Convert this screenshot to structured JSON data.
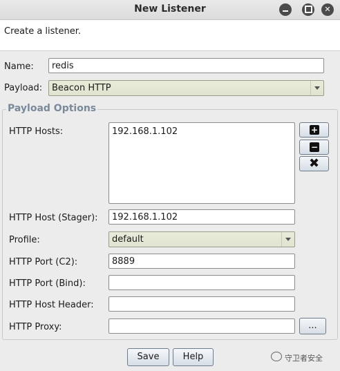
{
  "window": {
    "title": "New Listener"
  },
  "description": "Create a listener.",
  "form": {
    "name_label": "Name:",
    "name_value": "redis",
    "payload_label": "Payload:",
    "payload_value": "Beacon HTTP"
  },
  "payload_options": {
    "group_title": "Payload Options",
    "http_hosts_label": "HTTP Hosts:",
    "http_hosts": [
      "192.168.1.102"
    ],
    "host_stager_label": "HTTP Host (Stager):",
    "host_stager_value": "192.168.1.102",
    "profile_label": "Profile:",
    "profile_value": "default",
    "port_c2_label": "HTTP Port (C2):",
    "port_c2_value": "8889",
    "port_bind_label": "HTTP Port (Bind):",
    "port_bind_value": "",
    "host_header_label": "HTTP Host Header:",
    "host_header_value": "",
    "proxy_label": "HTTP Proxy:",
    "proxy_value": "",
    "proxy_button_label": "..."
  },
  "buttons": {
    "save": "Save",
    "help": "Help"
  },
  "watermark": "守卫者安全",
  "icons": {
    "add": "plus-icon",
    "remove": "minus-icon",
    "clear": "x-icon"
  }
}
